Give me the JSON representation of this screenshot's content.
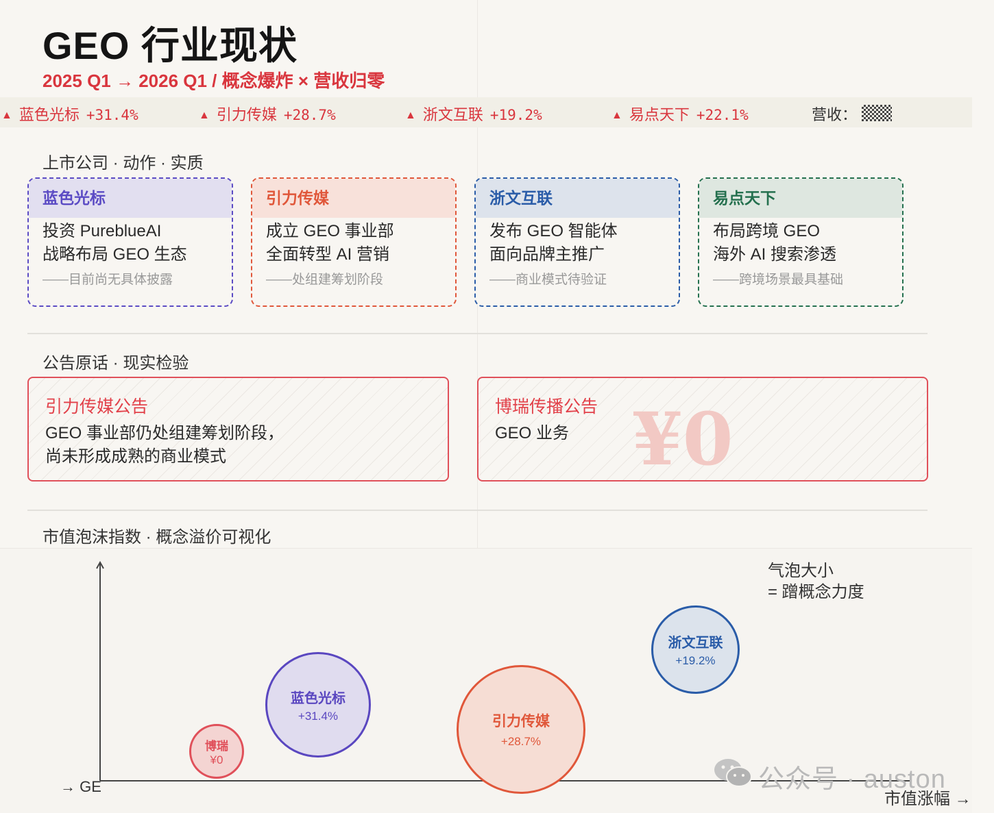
{
  "header": {
    "title": "GEO 行业现状",
    "subtitle": "2025 Q1 → 2026 Q1 / 概念爆炸 × 营收归零"
  },
  "ticker": {
    "items": [
      {
        "name": "蓝色光标",
        "change": "+31.4%"
      },
      {
        "name": "引力传媒",
        "change": "+28.7%"
      },
      {
        "name": "浙文互联",
        "change": "+19.2%"
      },
      {
        "name": "易点天下",
        "change": "+22.1%"
      }
    ],
    "revenue_label": "营收："
  },
  "sections": {
    "companies": "上市公司 · 动作 · 实质",
    "announcements": "公告原话 · 现实检验",
    "bubble": "市值泡沫指数 · 概念溢价可视化"
  },
  "cards": [
    {
      "name": "蓝色光标",
      "line1": "投资 PureblueAI",
      "line2": "战略布局 GEO 生态",
      "note": "——目前尚无具体披露",
      "color": "#5b4bc4",
      "bg": "#e2dff0"
    },
    {
      "name": "引力传媒",
      "line1": "成立 GEO 事业部",
      "line2": "全面转型 AI 营销",
      "note": "——处组建筹划阶段",
      "color": "#e0573a",
      "bg": "#f8e1da"
    },
    {
      "name": "浙文互联",
      "line1": "发布 GEO 智能体",
      "line2": "面向品牌主推广",
      "note": "——商业模式待验证",
      "color": "#2a5ca8",
      "bg": "#dde3ec"
    },
    {
      "name": "易点天下",
      "line1": "布局跨境 GEO",
      "line2": "海外 AI 搜索渗透",
      "note": "——跨境场景最具基础",
      "color": "#24704e",
      "bg": "#dee7e0"
    }
  ],
  "announcements": [
    {
      "title": "引力传媒公告",
      "line1": "GEO 事业部仍处组建筹划阶段，",
      "line2": "尚未形成成熟的商业模式"
    },
    {
      "title": "博瑞传播公告",
      "line1": "GEO 业务",
      "line2": "",
      "stamp": "¥0"
    }
  ],
  "chart_data": {
    "type": "scatter",
    "xlabel": "市值涨幅 →",
    "ylabel": "→ GE",
    "legend": [
      "气泡大小",
      "= 蹭概念力度"
    ],
    "grid": false,
    "bubbles": [
      {
        "name": "博瑞",
        "label": "¥0",
        "color": "#e0505a",
        "fill": "#f4d4d2"
      },
      {
        "name": "蓝色光标",
        "label": "+31.4%",
        "color": "#5a47c0",
        "fill": "#e0dcef"
      },
      {
        "name": "引力传媒",
        "label": "+28.7%",
        "color": "#e0573a",
        "fill": "#f6ddd4"
      },
      {
        "name": "浙文互联",
        "label": "+19.2%",
        "color": "#2a5ca8",
        "fill": "#dce3ec"
      }
    ]
  },
  "watermark": "公众号 · auston"
}
